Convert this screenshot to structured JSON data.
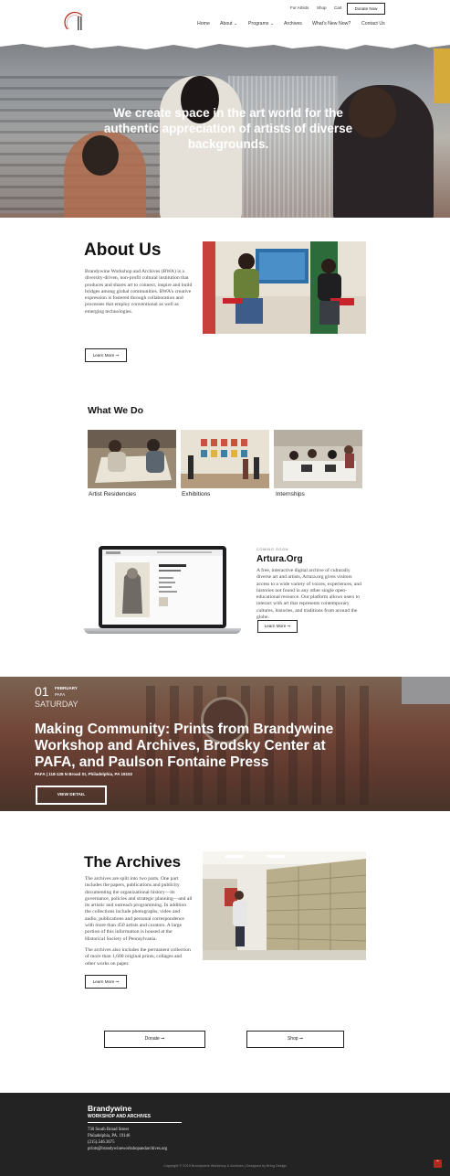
{
  "header": {
    "logo_icon": "brandywine-logo-icon",
    "utility_links": [
      "For Artists",
      "Shop",
      "Cart"
    ],
    "donate_label": "Donate Now",
    "nav": [
      "Home",
      "About",
      "Programs",
      "Archives",
      "What's New Now?",
      "Contact Us"
    ],
    "dropdown_glyph": "⌄"
  },
  "hero": {
    "title": "We create space in the art world for the authentic appreciation of artists of diverse backgrounds."
  },
  "about": {
    "heading": "About Us",
    "body": "Brandywine Workshop and Archives (BWA) is a diversity-driven, non-profit cultural institution that produces and shares art to connect, inspire and build bridges among global communities. BWA's creative expression is fostered through collaboration and processes that employ conventional as well as emerging technologies.",
    "button": "Learn More ➞"
  },
  "what_we_do": {
    "heading": "What We Do",
    "items": [
      "Artist Residencies",
      "Exhibitions",
      "Internships"
    ]
  },
  "artura": {
    "kicker": "COMING SOON",
    "heading": "Artura.Org",
    "body": "A free, interactive digital archive of culturally diverse art and artists, Artura.org gives visitors access to a wide variety of voices, experiences, and histories not found in any other single open-educational resource. Our platform allows users to interact with art that represents contemporary cultures, histories, and traditions from around the globe.",
    "button": "Learn More ➞"
  },
  "event": {
    "day": "01",
    "month": "FEBRUARY",
    "place_short": "PAFA",
    "weekday": "SATURDAY",
    "title": "Making Community: Prints from Brandywine Workshop and Archives, Brodsky Center at PAFA, and Paulson Fontaine Press",
    "address": "PAFA | 118-128 N Broad St, Philadelphia, PA 19102",
    "button": "VIEW DETAIL"
  },
  "archives": {
    "heading": "The Archives",
    "body1": "The archives are split into two parts. One part includes the papers, publications and publicity documenting the organizational history—its governance, policies and strategic planning—and all its artistic and outreach programming. In addition the collections include photographs, video and audio, publications and personal correspondence with more than 450 artists and curators. A large portion of this information is housed at the Historical Society of Pennsylvania.",
    "body2": "The archives also includes the permanent collection of more than 1,600 original prints, collages and other works on paper.",
    "button": "Learn More ➞"
  },
  "cta": {
    "donate": "Donate ➞",
    "shop": "Shop ➞"
  },
  "footer": {
    "brand": "Brandywine",
    "sub": "WORKSHOP AND ARCHIVES",
    "address_lines": [
      "730 South Broad Street",
      "Philadelphia, PA. 19146",
      "(215).546.3675",
      "prints@brandywineworkshopandarchives.org"
    ],
    "copyright": "Copyright © 2019 Brandywine Workshop & Archives | Designed by Bring Design",
    "top_glyph": "⌃"
  },
  "colors": {
    "accent": "#b3281d",
    "footer_bg": "#232323"
  }
}
